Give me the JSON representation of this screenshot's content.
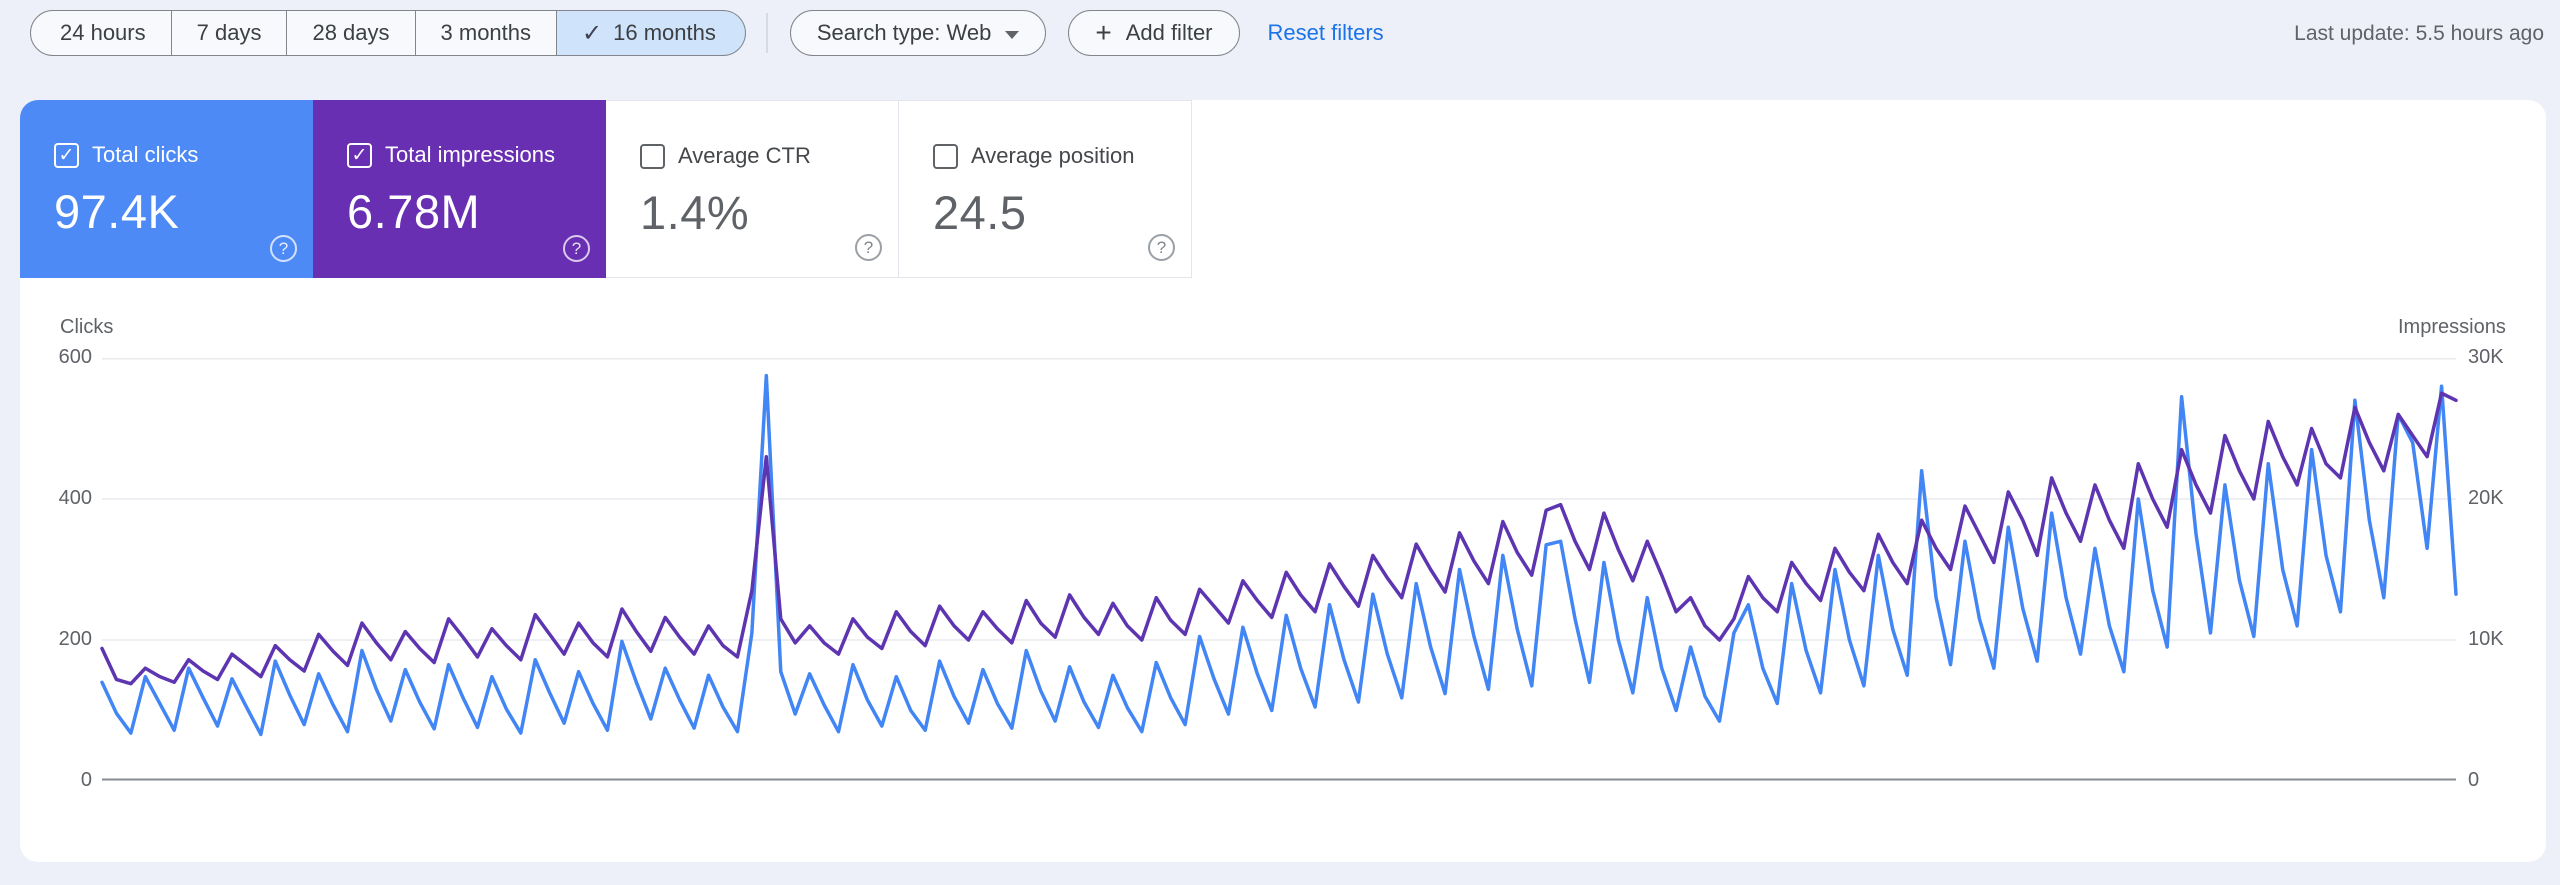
{
  "filter_bar": {
    "date_ranges": [
      {
        "label": "24 hours",
        "selected": false
      },
      {
        "label": "7 days",
        "selected": false
      },
      {
        "label": "28 days",
        "selected": false
      },
      {
        "label": "3 months",
        "selected": false
      },
      {
        "label": "16 months",
        "selected": true
      }
    ],
    "search_type_label": "Search type: Web",
    "add_filter_label": "Add filter",
    "reset_filters_label": "Reset filters",
    "last_update": "Last update: 5.5 hours ago",
    "selected_range_bg": "#cfe3fb"
  },
  "icons": {
    "check": "✓",
    "plus": "+",
    "help": "?"
  },
  "metric_cards": [
    {
      "label": "Total clicks",
      "value": "97.4K",
      "checked": true,
      "bg": "#4d8af5"
    },
    {
      "label": "Total impressions",
      "value": "6.78M",
      "checked": true,
      "bg": "#692fb3"
    },
    {
      "label": "Average CTR",
      "value": "1.4%",
      "checked": false,
      "bg": "#ffffff"
    },
    {
      "label": "Average position",
      "value": "24.5",
      "checked": false,
      "bg": "#ffffff"
    }
  ],
  "chart_data": {
    "type": "line",
    "title": "Search performance over time (16 months, daily points; x-axis date labels not visible)",
    "grid": true,
    "legend_position": "none",
    "x_axis": {
      "label": "",
      "tick_labels": []
    },
    "left_axis": {
      "title": "Clicks",
      "ticks": [
        0,
        200,
        400,
        600
      ],
      "range": [
        0,
        600
      ],
      "ticks_display_top_down": [
        "600",
        "400",
        "200",
        "0"
      ]
    },
    "right_axis": {
      "title": "Impressions",
      "ticks": [
        0,
        10000,
        20000,
        30000
      ],
      "range": [
        0,
        30000
      ],
      "ticks_display_top_down": [
        "30K",
        "20K",
        "10K",
        "0"
      ]
    },
    "series": [
      {
        "name": "Clicks",
        "axis": "left",
        "color": "#4285f4",
        "values": [
          140,
          96,
          68,
          148,
          110,
          72,
          160,
          118,
          78,
          145,
          105,
          66,
          170,
          122,
          80,
          152,
          108,
          70,
          185,
          130,
          85,
          158,
          112,
          74,
          165,
          118,
          76,
          148,
          102,
          68,
          172,
          125,
          82,
          155,
          110,
          72,
          198,
          140,
          88,
          160,
          115,
          75,
          150,
          105,
          70,
          210,
          575,
          155,
          95,
          152,
          108,
          70,
          165,
          115,
          78,
          148,
          100,
          72,
          170,
          120,
          82,
          158,
          110,
          75,
          185,
          128,
          85,
          162,
          112,
          76,
          150,
          104,
          70,
          168,
          118,
          80,
          205,
          145,
          95,
          218,
          152,
          100,
          235,
          160,
          105,
          250,
          172,
          112,
          265,
          180,
          118,
          280,
          190,
          124,
          300,
          205,
          130,
          320,
          215,
          135,
          335,
          340,
          230,
          140,
          310,
          200,
          125,
          260,
          160,
          100,
          190,
          120,
          85,
          210,
          250,
          160,
          110,
          280,
          185,
          125,
          300,
          200,
          135,
          320,
          215,
          150,
          440,
          260,
          165,
          340,
          230,
          160,
          360,
          245,
          170,
          380,
          260,
          180,
          330,
          220,
          155,
          400,
          270,
          190,
          545,
          350,
          210,
          420,
          285,
          205,
          450,
          300,
          220,
          470,
          320,
          240,
          540,
          370,
          260,
          520,
          480,
          330,
          560,
          265
        ]
      },
      {
        "name": "Impressions",
        "axis": "right",
        "color": "#5e35b1",
        "values": [
          9400,
          7200,
          6900,
          8000,
          7400,
          7000,
          8600,
          7800,
          7200,
          9000,
          8200,
          7400,
          9600,
          8600,
          7800,
          10400,
          9200,
          8200,
          11200,
          9800,
          8600,
          10600,
          9400,
          8400,
          11500,
          10200,
          8800,
          10800,
          9600,
          8600,
          11800,
          10400,
          9000,
          11200,
          9800,
          8800,
          12200,
          10600,
          9200,
          11600,
          10200,
          9000,
          11000,
          9600,
          8800,
          13500,
          23000,
          11500,
          9800,
          11000,
          9800,
          9000,
          11500,
          10200,
          9400,
          12000,
          10600,
          9600,
          12400,
          11000,
          10000,
          12000,
          10800,
          9800,
          12800,
          11200,
          10200,
          13200,
          11600,
          10400,
          12600,
          11000,
          10000,
          13000,
          11400,
          10400,
          13600,
          12400,
          11200,
          14200,
          12800,
          11600,
          14800,
          13200,
          12000,
          15400,
          13800,
          12400,
          16000,
          14400,
          13000,
          16800,
          15000,
          13400,
          17600,
          15600,
          14000,
          18400,
          16200,
          14600,
          19200,
          19600,
          17000,
          15000,
          19000,
          16400,
          14200,
          17000,
          14600,
          12000,
          13000,
          11000,
          10000,
          11500,
          14500,
          13000,
          12000,
          15500,
          14000,
          12800,
          16500,
          14800,
          13500,
          17500,
          15500,
          14000,
          18500,
          16500,
          15000,
          19500,
          17500,
          15500,
          20500,
          18500,
          16000,
          21500,
          19000,
          17000,
          21000,
          18500,
          16500,
          22500,
          20000,
          18000,
          23500,
          21000,
          19000,
          24500,
          22000,
          20000,
          25500,
          23000,
          21000,
          25000,
          22500,
          21500,
          26500,
          24000,
          22000,
          26000,
          24500,
          23000,
          27500,
          27000
        ]
      }
    ]
  }
}
